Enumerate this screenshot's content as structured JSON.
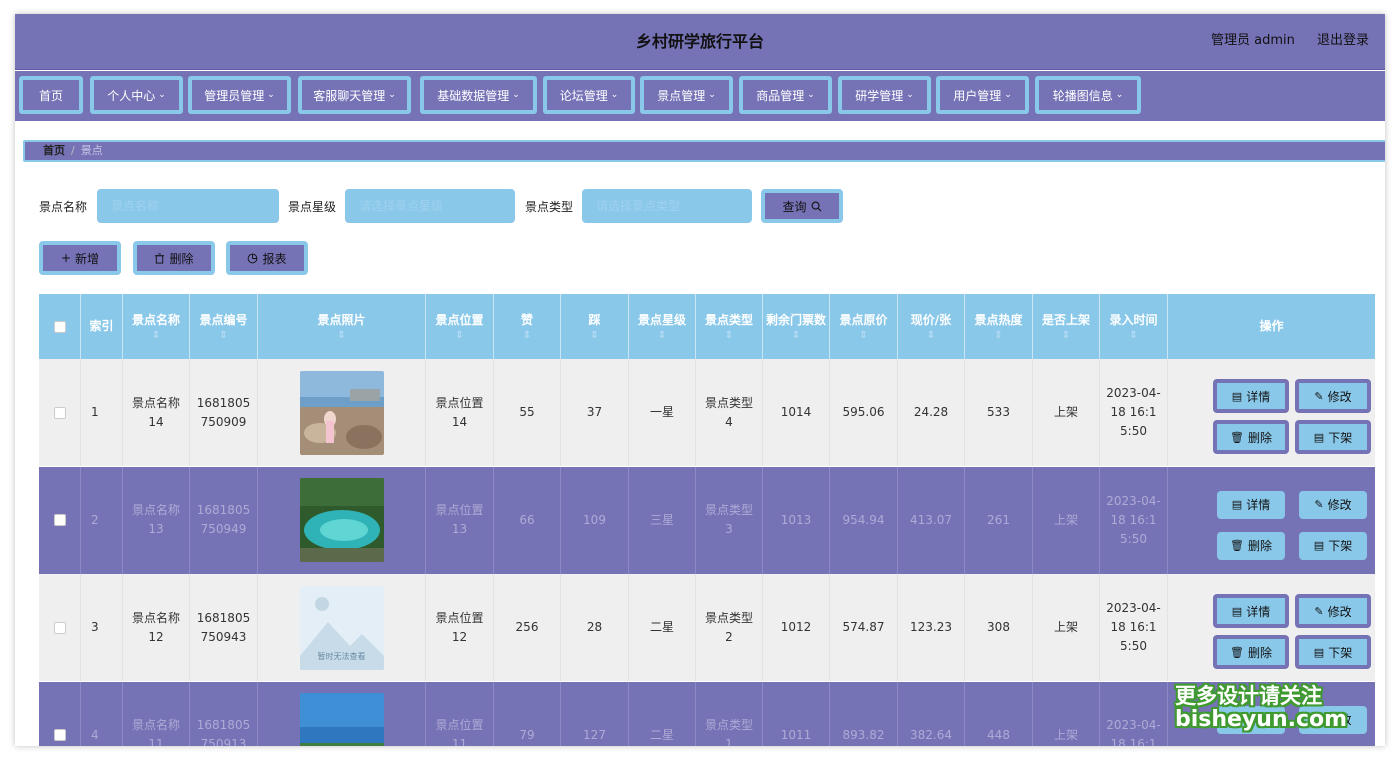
{
  "app": {
    "title": "乡村研学旅行平台",
    "user": "管理员 admin",
    "logout": "退出登录"
  },
  "nav": [
    {
      "label": "首页",
      "dropdown": false
    },
    {
      "label": "个人中心",
      "dropdown": true
    },
    {
      "label": "管理员管理",
      "dropdown": true
    },
    {
      "label": "客服聊天管理",
      "dropdown": true
    },
    {
      "label": "基础数据管理",
      "dropdown": true
    },
    {
      "label": "论坛管理",
      "dropdown": true
    },
    {
      "label": "景点管理",
      "dropdown": true
    },
    {
      "label": "商品管理",
      "dropdown": true
    },
    {
      "label": "研学管理",
      "dropdown": true
    },
    {
      "label": "用户管理",
      "dropdown": true
    },
    {
      "label": "轮播图信息",
      "dropdown": true
    }
  ],
  "breadcrumb": {
    "home": "首页",
    "sep": "/",
    "current": "景点"
  },
  "search": {
    "name_label": "景点名称",
    "name_placeholder": "景点名称",
    "star_label": "景点星级",
    "star_placeholder": "请选择景点星级",
    "type_label": "景点类型",
    "type_placeholder": "请选择景点类型",
    "query": "查询"
  },
  "actions": {
    "add": "新增",
    "delete": "删除",
    "report": "报表"
  },
  "table": {
    "headers": [
      "索引",
      "景点名称",
      "景点编号",
      "景点照片",
      "景点位置",
      "赞",
      "踩",
      "景点星级",
      "景点类型",
      "剩余门票数",
      "景点原价",
      "现价/张",
      "景点热度",
      "是否上架",
      "录入时间",
      "操作"
    ],
    "rows": [
      {
        "index": "1",
        "name": "景点名称14",
        "code": "1681805750909",
        "photo": "beach",
        "location": "景点位置14",
        "likes": "55",
        "dislikes": "37",
        "star": "一星",
        "type": "景点类型4",
        "tickets": "1014",
        "orig_price": "595.06",
        "price": "24.28",
        "heat": "533",
        "on_shelf": "上架",
        "time": "2023-04-18 16:15:50"
      },
      {
        "index": "2",
        "name": "景点名称13",
        "code": "1681805750949",
        "photo": "lake",
        "location": "景点位置13",
        "likes": "66",
        "dislikes": "109",
        "star": "三星",
        "type": "景点类型3",
        "tickets": "1013",
        "orig_price": "954.94",
        "price": "413.07",
        "heat": "261",
        "on_shelf": "上架",
        "time": "2023-04-18 16:15:50"
      },
      {
        "index": "3",
        "name": "景点名称12",
        "code": "1681805750943",
        "photo": "placeholder",
        "location": "景点位置12",
        "likes": "256",
        "dislikes": "28",
        "star": "二星",
        "type": "景点类型2",
        "tickets": "1012",
        "orig_price": "574.87",
        "price": "123.23",
        "heat": "308",
        "on_shelf": "上架",
        "time": "2023-04-18 16:15:50"
      },
      {
        "index": "4",
        "name": "景点名称11",
        "code": "1681805750913",
        "photo": "sea",
        "location": "景点位置11",
        "likes": "79",
        "dislikes": "127",
        "star": "二星",
        "type": "景点类型1",
        "tickets": "1011",
        "orig_price": "893.82",
        "price": "382.64",
        "heat": "448",
        "on_shelf": "上架",
        "time": "2023-04-18 16:1"
      }
    ],
    "ops": {
      "detail": "详情",
      "edit": "修改",
      "delete": "删除",
      "off_shelf": "下架"
    },
    "no_image_text": "暂时无法查看"
  },
  "watermark": {
    "line1": "更多设计请关注",
    "line2": "bisheyun.com"
  },
  "colors": {
    "primary": "#7672b6",
    "accent": "#8ac8ea"
  }
}
